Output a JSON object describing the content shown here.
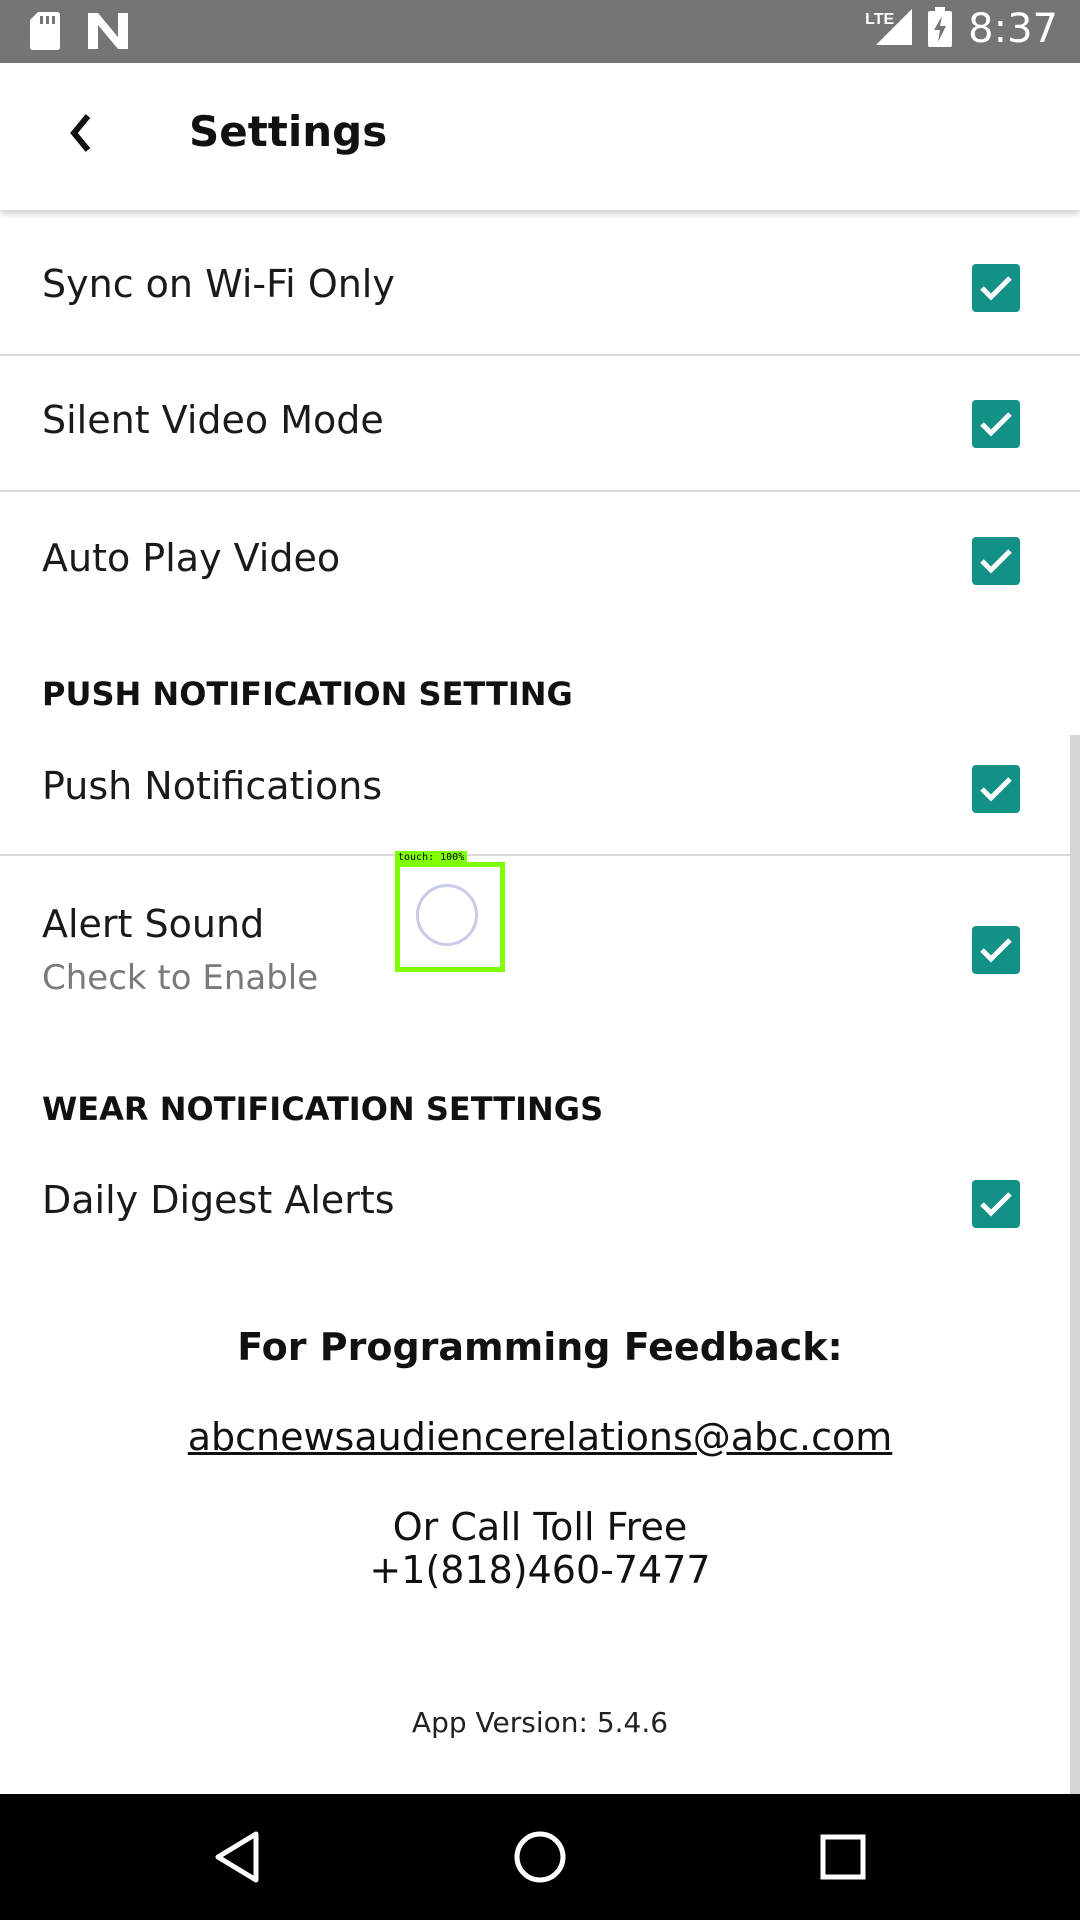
{
  "status_bar": {
    "time": "8:37",
    "network_label": "LTE",
    "icons": [
      "sd-card-icon",
      "n-logo-icon",
      "signal-icon",
      "battery-charging-icon"
    ]
  },
  "header": {
    "back_icon": "chevron-left-icon",
    "title": "Settings"
  },
  "rows": {
    "sync_wifi": {
      "label": "Sync on Wi-Fi Only",
      "checked": true
    },
    "silent_video": {
      "label": "Silent Video Mode",
      "checked": true
    },
    "auto_play": {
      "label": "Auto Play Video",
      "checked": true
    },
    "push_notifications": {
      "label": "Push Notifications",
      "checked": true
    },
    "alert_sound": {
      "label": "Alert Sound",
      "sublabel": "Check to Enable",
      "checked": true
    },
    "daily_digest": {
      "label": "Daily Digest Alerts",
      "checked": true
    }
  },
  "sections": {
    "push": "PUSH NOTIFICATION SETTING",
    "wear": "WEAR NOTIFICATION SETTINGS"
  },
  "footer": {
    "feedback_heading": "For Programming Feedback:",
    "email": "abcnewsaudiencerelations@abc.com",
    "call_label": "Or Call Toll Free",
    "phone": "+1(818)460-7477",
    "app_version": "App Version: 5.4.6"
  },
  "touch_overlay": {
    "label": "touch: 100%"
  },
  "colors": {
    "status_bar": "#757575",
    "checkbox": "#139187",
    "nav_bar": "#000000",
    "touch_box": "#7fff00"
  },
  "nav": {
    "icons": [
      "back-triangle-icon",
      "home-circle-icon",
      "recents-square-icon"
    ]
  }
}
